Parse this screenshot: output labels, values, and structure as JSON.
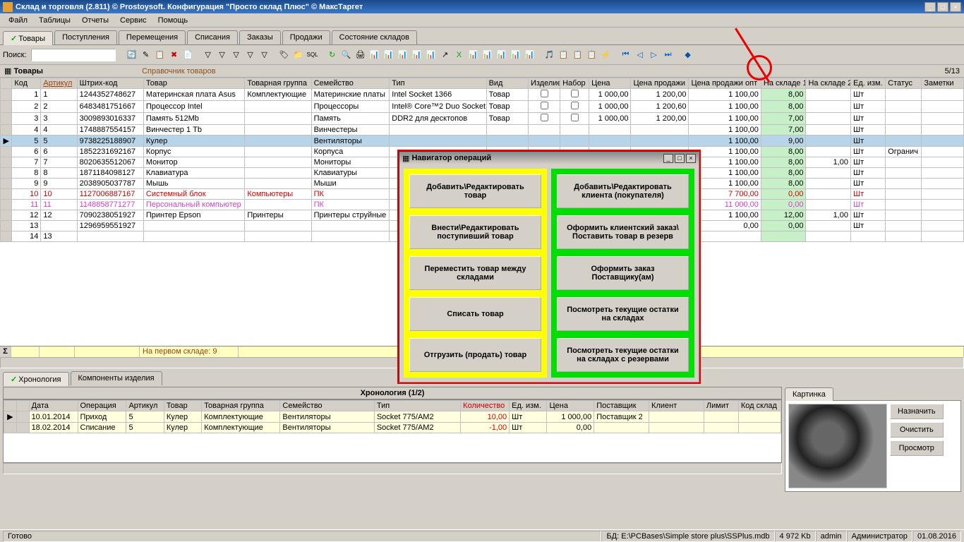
{
  "window": {
    "title": "Склад и торговля (2.811) © Prostoysoft. Конфигурация \"Просто склад Плюс\" © МаксТаргет",
    "min": "_",
    "max": "□",
    "close": "×"
  },
  "menu": {
    "file": "Файл",
    "tables": "Таблицы",
    "reports": "Отчеты",
    "service": "Сервис",
    "help": "Помощь"
  },
  "maintabs": {
    "goods": "Товары",
    "receipts": "Поступления",
    "moves": "Перемещения",
    "writeoffs": "Списания",
    "orders": "Заказы",
    "sales": "Продажи",
    "state": "Состояние складов"
  },
  "toolbar": {
    "search_label": "Поиск:",
    "search_value": ""
  },
  "panel": {
    "title": "Товары",
    "subtitle": "Справочник товаров",
    "count": "5/13"
  },
  "columns": {
    "code": "Код",
    "article": "Артикул",
    "barcode": "Штрих-код",
    "name": "Товар",
    "group": "Товарная группа",
    "family": "Семейство",
    "type": "Тип",
    "kind": "Вид",
    "product": "Изделие",
    "set": "Набор",
    "price": "Цена",
    "sale": "Цена продажи",
    "whole": "Цена продажи опт",
    "stock1": "На складе 1",
    "stock2": "На складе 2",
    "unit": "Ед. изм.",
    "status": "Статус",
    "notes": "Заметки"
  },
  "rows": [
    {
      "n": "1",
      "code": "1",
      "bar": "1244352748627",
      "name": "Материнская плата Asus",
      "grp": "Комплектующие",
      "fam": "Материнские платы",
      "type": "Intel Socket 1366",
      "kind": "Товар",
      "price": "1 000,00",
      "sale": "1 200,00",
      "whole": "1 100,00",
      "s1": "8,00",
      "s2": "",
      "unit": "Шт",
      "status": "",
      "cls": "",
      "prod": "cb",
      "set": "cb"
    },
    {
      "n": "2",
      "code": "2",
      "bar": "6483481751667",
      "name": "Процессор Intel",
      "grp": "",
      "fam": "Процессоры",
      "type": "Intel® Core™2 Duo Socket",
      "kind": "Товар",
      "price": "1 000,00",
      "sale": "1 200,60",
      "whole": "1 100,00",
      "s1": "8,00",
      "s2": "",
      "unit": "Шт",
      "status": "",
      "cls": "",
      "prod": "cb",
      "set": "cb"
    },
    {
      "n": "3",
      "code": "3",
      "bar": "3009893016337",
      "name": "Память 512Mb",
      "grp": "",
      "fam": "Память",
      "type": "DDR2 для десктопов",
      "kind": "Товар",
      "price": "1 000,00",
      "sale": "1 200,00",
      "whole": "1 100,00",
      "s1": "7,00",
      "s2": "",
      "unit": "Шт",
      "status": "",
      "cls": "",
      "prod": "cb",
      "set": "cb"
    },
    {
      "n": "4",
      "code": "4",
      "bar": "1748887554157",
      "name": "Винчестер 1 Tb",
      "grp": "",
      "fam": "Винчестеры",
      "type": "",
      "kind": "",
      "price": "",
      "sale": "",
      "whole": "1 100,00",
      "s1": "7,00",
      "s2": "",
      "unit": "Шт",
      "status": "",
      "cls": ""
    },
    {
      "n": "5",
      "code": "5",
      "bar": "9738225188907",
      "name": "Кулер",
      "grp": "",
      "fam": "Вентиляторы",
      "type": "",
      "kind": "",
      "price": "",
      "sale": "",
      "whole": "1 100,00",
      "s1": "9,00",
      "s2": "",
      "unit": "Шт",
      "status": "",
      "cls": "sel",
      "arrow": "▶"
    },
    {
      "n": "6",
      "code": "6",
      "bar": "1852231692167",
      "name": "Корпус",
      "grp": "",
      "fam": "Корпуса",
      "type": "",
      "kind": "",
      "price": "",
      "sale": "",
      "whole": "1 100,00",
      "s1": "8,00",
      "s2": "",
      "unit": "Шт",
      "status": "Огранич",
      "cls": ""
    },
    {
      "n": "7",
      "code": "7",
      "bar": "8020635512067",
      "name": "Монитор",
      "grp": "",
      "fam": "Мониторы",
      "type": "",
      "kind": "",
      "price": "",
      "sale": "",
      "whole": "1 100,00",
      "s1": "8,00",
      "s2": "1,00",
      "unit": "Шт",
      "status": "",
      "cls": ""
    },
    {
      "n": "8",
      "code": "8",
      "bar": "1871184098127",
      "name": "Клавиатура",
      "grp": "",
      "fam": "Клавиатуры",
      "type": "",
      "kind": "",
      "price": "",
      "sale": "",
      "whole": "1 100,00",
      "s1": "8,00",
      "s2": "",
      "unit": "Шт",
      "status": "",
      "cls": ""
    },
    {
      "n": "9",
      "code": "9",
      "bar": "2038905037787",
      "name": "Мышь",
      "grp": "",
      "fam": "Мыши",
      "type": "",
      "kind": "",
      "price": "",
      "sale": "",
      "whole": "1 100,00",
      "s1": "8,00",
      "s2": "",
      "unit": "Шт",
      "status": "",
      "cls": ""
    },
    {
      "n": "10",
      "code": "10",
      "bar": "1127006887167",
      "name": "Системный блок",
      "grp": "Компьютеры",
      "fam": "ПК",
      "type": "",
      "kind": "",
      "price": "",
      "sale": "",
      "whole": "7 700,00",
      "s1": "0,00",
      "s2": "",
      "unit": "Шт",
      "status": "",
      "cls": "red"
    },
    {
      "n": "11",
      "code": "11",
      "bar": "1148858771277",
      "name": "Персональный компьютер",
      "grp": "",
      "fam": "ПК",
      "type": "",
      "kind": "",
      "price": "",
      "sale": "",
      "whole": "11 000,00",
      "s1": "0,00",
      "s2": "",
      "unit": "Шт",
      "status": "",
      "cls": "pink"
    },
    {
      "n": "12",
      "code": "12",
      "bar": "7090238051927",
      "name": "Принтер Epson",
      "grp": "Принтеры",
      "fam": "Принтеры струйные",
      "type": "",
      "kind": "",
      "price": "",
      "sale": "",
      "whole": "1 100,00",
      "s1": "12,00",
      "s2": "1,00",
      "unit": "Шт",
      "status": "",
      "cls": ""
    },
    {
      "n": "13",
      "code": "",
      "bar": "1296959551927",
      "name": "",
      "grp": "",
      "fam": "",
      "type": "",
      "kind": "",
      "price": "",
      "sale": "",
      "whole": "0,00",
      "s1": "0,00",
      "s2": "",
      "unit": "Шт",
      "status": "",
      "cls": ""
    },
    {
      "n": "14",
      "code": "13",
      "bar": "",
      "name": "",
      "grp": "",
      "fam": "",
      "type": "",
      "kind": "",
      "price": "",
      "sale": "",
      "whole": "",
      "s1": "",
      "s2": "",
      "unit": "",
      "status": "",
      "cls": ""
    }
  ],
  "summary": {
    "text": "На первом складе: 9"
  },
  "lowertabs": {
    "chrono": "Хронология",
    "components": "Компоненты изделия"
  },
  "chronology": {
    "title": "Хронология (1/2)",
    "cols": {
      "date": "Дата",
      "op": "Операция",
      "art": "Артикул",
      "name": "Товар",
      "grp": "Товарная группа",
      "fam": "Семейство",
      "type": "Тип",
      "qty": "Количество",
      "unit": "Ед. изм.",
      "price": "Цена",
      "supplier": "Поставщик",
      "client": "Клиент",
      "limit": "Лимит",
      "wcode": "Код склад"
    },
    "rows": [
      {
        "date": "10.01.2014",
        "op": "Приход",
        "art": "5",
        "name": "Кулер",
        "grp": "Комплектующие",
        "fam": "Вентиляторы",
        "type": "Socket 775/AM2",
        "qty": "10,00",
        "unit": "Шт",
        "price": "1 000,00",
        "supplier": "Поставщик 2",
        "client": "",
        "arrow": "▶"
      },
      {
        "date": "18.02.2014",
        "op": "Списание",
        "art": "5",
        "name": "Кулер",
        "grp": "Комплектующие",
        "fam": "Вентиляторы",
        "type": "Socket 775/AM2",
        "qty": "-1,00",
        "unit": "Шт",
        "price": "0,00",
        "supplier": "",
        "client": ""
      }
    ]
  },
  "picture": {
    "title": "Картинка",
    "assign": "Назначить",
    "clear": "Очистить",
    "view": "Просмотр"
  },
  "navigator": {
    "title": "Навигатор операций",
    "yellow": {
      "b1": "Добавить\\Редактировать товар",
      "b2": "Внести\\Редактировать поступивший товар",
      "b3": "Переместить товар между складами",
      "b4": "Списать товар",
      "b5": "Отгрузить (продать) товар"
    },
    "green": {
      "b1": "Добавить\\Редактировать клиента (покупателя)",
      "b2": "Оформить клиентский заказ\\ Поставить товар в резерв",
      "b3": "Оформить заказ Поставщику(ам)",
      "b4": "Посмотреть текущие остатки на складах",
      "b5": "Посмотреть текущие остатки на складах с резервами"
    }
  },
  "status": {
    "ready": "Готово",
    "db_label": "БД:",
    "db_path": "E:\\PCBases\\Simple store plus\\SSPlus.mdb",
    "size": "4 972 Kb",
    "user": "admin",
    "role": "Администратор",
    "date": "01.08.2016"
  }
}
